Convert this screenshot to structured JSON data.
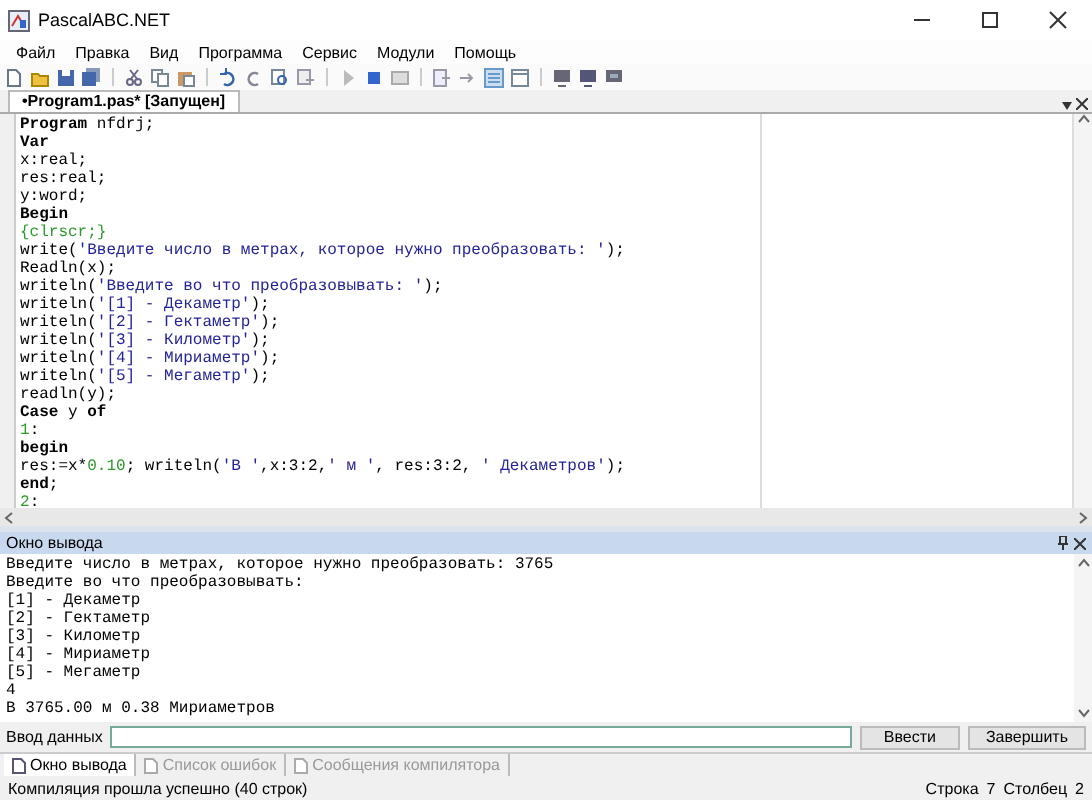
{
  "window": {
    "title": "PascalABC.NET"
  },
  "menu": [
    "Файл",
    "Правка",
    "Вид",
    "Программа",
    "Сервис",
    "Модули",
    "Помощь"
  ],
  "editor_tabs": [
    {
      "label": "•Program1.pas* [Запущен]",
      "selected": true
    }
  ],
  "code": [
    [
      {
        "kind": "keyword",
        "text": "Program"
      },
      {
        "kind": "plain",
        "text": " nfdrj;"
      }
    ],
    [
      {
        "kind": "keyword",
        "text": "Var"
      }
    ],
    [
      {
        "kind": "plain",
        "text": "x:real;"
      }
    ],
    [
      {
        "kind": "plain",
        "text": "res:real;"
      }
    ],
    [
      {
        "kind": "plain",
        "text": "y:word;"
      }
    ],
    [
      {
        "kind": "keyword",
        "text": "Begin"
      }
    ],
    [
      {
        "kind": "comment",
        "text": "{clrscr;}"
      }
    ],
    [
      {
        "kind": "plain",
        "text": "write("
      },
      {
        "kind": "string",
        "text": "'Введите число в метрах, которое нужно преобразовать: '"
      },
      {
        "kind": "plain",
        "text": ");"
      }
    ],
    [
      {
        "kind": "plain",
        "text": "Readln(x);"
      }
    ],
    [
      {
        "kind": "plain",
        "text": "writeln("
      },
      {
        "kind": "string",
        "text": "'Введите во что преобразовывать: '"
      },
      {
        "kind": "plain",
        "text": ");"
      }
    ],
    [
      {
        "kind": "plain",
        "text": "writeln("
      },
      {
        "kind": "string",
        "text": "'[1] - Декаметр'"
      },
      {
        "kind": "plain",
        "text": ");"
      }
    ],
    [
      {
        "kind": "plain",
        "text": "writeln("
      },
      {
        "kind": "string",
        "text": "'[2] - Гектаметр'"
      },
      {
        "kind": "plain",
        "text": ");"
      }
    ],
    [
      {
        "kind": "plain",
        "text": "writeln("
      },
      {
        "kind": "string",
        "text": "'[3] - Километр'"
      },
      {
        "kind": "plain",
        "text": ");"
      }
    ],
    [
      {
        "kind": "plain",
        "text": "writeln("
      },
      {
        "kind": "string",
        "text": "'[4] - Мириаметр'"
      },
      {
        "kind": "plain",
        "text": ");"
      }
    ],
    [
      {
        "kind": "plain",
        "text": "writeln("
      },
      {
        "kind": "string",
        "text": "'[5] - Мегаметр'"
      },
      {
        "kind": "plain",
        "text": ");"
      }
    ],
    [
      {
        "kind": "plain",
        "text": "readln(y);"
      }
    ],
    [
      {
        "kind": "keyword",
        "text": "Case"
      },
      {
        "kind": "plain",
        "text": " y "
      },
      {
        "kind": "keyword",
        "text": "of"
      }
    ],
    [
      {
        "kind": "number",
        "text": "1"
      },
      {
        "kind": "plain",
        "text": ":"
      }
    ],
    [
      {
        "kind": "keyword",
        "text": "begin"
      }
    ],
    [
      {
        "kind": "plain",
        "text": "res:=x*"
      },
      {
        "kind": "number",
        "text": "0.10"
      },
      {
        "kind": "plain",
        "text": "; writeln("
      },
      {
        "kind": "string",
        "text": "'В '"
      },
      {
        "kind": "plain",
        "text": ",x:3:2,"
      },
      {
        "kind": "string",
        "text": "' м '"
      },
      {
        "kind": "plain",
        "text": ", res:3:2, "
      },
      {
        "kind": "string",
        "text": "' Декаметров'"
      },
      {
        "kind": "plain",
        "text": ");"
      }
    ],
    [
      {
        "kind": "keyword",
        "text": "end"
      },
      {
        "kind": "plain",
        "text": ";"
      }
    ],
    [
      {
        "kind": "number",
        "text": "2"
      },
      {
        "kind": "plain",
        "text": ":"
      }
    ]
  ],
  "output": {
    "title": "Окно вывода",
    "lines": [
      "Введите число в метрах, которое нужно преобразовать: 3765",
      "Введите во что преобразовывать:",
      "[1] - Декаметр",
      "[2] - Гектаметр",
      "[3] - Километр",
      "[4] - Мириаметр",
      "[5] - Мегаметр",
      "4",
      "В 3765.00 м 0.38 Мириаметров"
    ]
  },
  "input": {
    "label": "Ввод данных",
    "buttons": [
      "Ввести",
      "Завершить"
    ]
  },
  "bottom_tabs": [
    {
      "label": "Окно вывода",
      "selected": true
    },
    {
      "label": "Список ошибок",
      "selected": false
    },
    {
      "label": "Сообщения компилятора",
      "selected": false
    }
  ],
  "status_bar": {
    "message": "Компиляция прошла успешно (40 строк)",
    "line_label": "Строка",
    "line": "7",
    "column_label": "Столбец",
    "column": "2"
  }
}
